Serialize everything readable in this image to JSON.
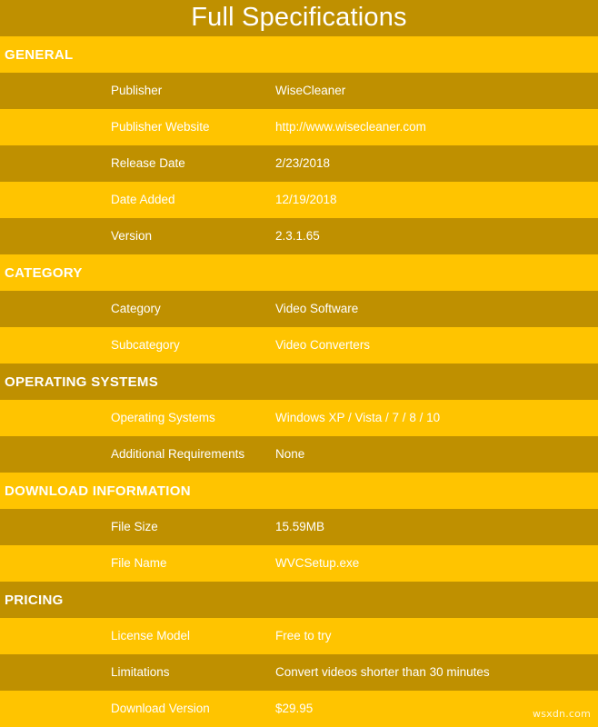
{
  "page": {
    "title": "Full Specifications",
    "watermark": "wsxdn.com",
    "colors": {
      "band_light": "#ffc400",
      "band_dark": "#bf9000",
      "text": "#ffffff"
    }
  },
  "rows": [
    {
      "kind": "section",
      "title": "GENERAL",
      "band": "light"
    },
    {
      "kind": "data",
      "label": "Publisher",
      "value": "WiseCleaner",
      "band": "dark"
    },
    {
      "kind": "data",
      "label": "Publisher Website",
      "value": "http://www.wisecleaner.com",
      "band": "light"
    },
    {
      "kind": "data",
      "label": "Release Date",
      "value": "2/23/2018",
      "band": "dark"
    },
    {
      "kind": "data",
      "label": "Date Added",
      "value": "12/19/2018",
      "band": "light"
    },
    {
      "kind": "data",
      "label": "Version",
      "value": "2.3.1.65",
      "band": "dark"
    },
    {
      "kind": "section",
      "title": "CATEGORY",
      "band": "light"
    },
    {
      "kind": "data",
      "label": "Category",
      "value": "Video Software",
      "band": "dark"
    },
    {
      "kind": "data",
      "label": "Subcategory",
      "value": "Video Converters",
      "band": "light"
    },
    {
      "kind": "section",
      "title": "OPERATING SYSTEMS",
      "band": "dark"
    },
    {
      "kind": "data",
      "label": "Operating Systems",
      "value": "Windows XP / Vista / 7 / 8 / 10",
      "band": "light"
    },
    {
      "kind": "data",
      "label": "Additional Requirements",
      "value": "None",
      "band": "dark"
    },
    {
      "kind": "section",
      "title": "DOWNLOAD INFORMATION",
      "band": "light"
    },
    {
      "kind": "data",
      "label": "File Size",
      "value": "15.59MB",
      "band": "dark"
    },
    {
      "kind": "data",
      "label": "File Name",
      "value": "WVCSetup.exe",
      "band": "light"
    },
    {
      "kind": "section",
      "title": "PRICING",
      "band": "dark"
    },
    {
      "kind": "data",
      "label": "License Model",
      "value": "Free to try",
      "band": "light"
    },
    {
      "kind": "data",
      "label": "Limitations",
      "value": "Convert videos shorter than 30 minutes",
      "band": "dark"
    },
    {
      "kind": "data",
      "label": "Download Version",
      "value": "$29.95",
      "band": "light"
    }
  ]
}
